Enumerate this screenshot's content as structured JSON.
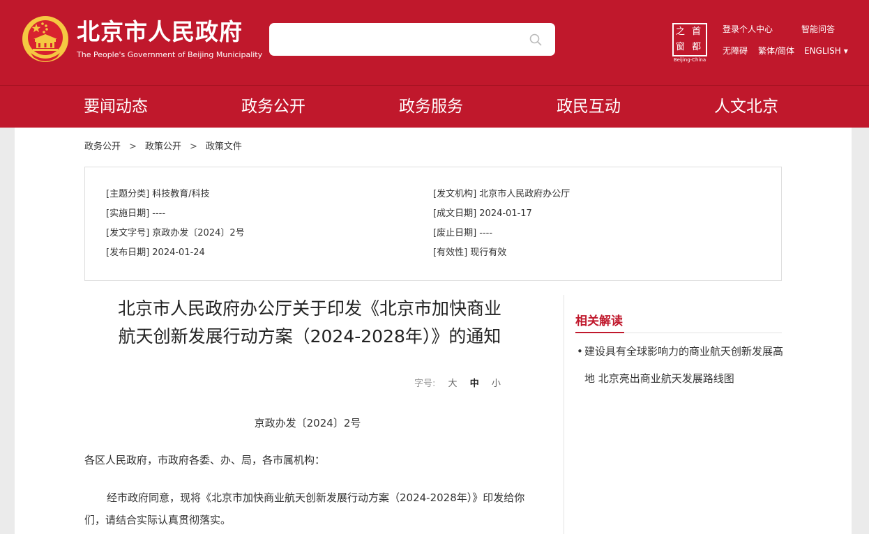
{
  "header": {
    "site_title": "北京市人民政府",
    "site_subtitle": "The People's Government of Beijing Municipality",
    "search": {
      "placeholder": ""
    },
    "capital_logo": {
      "chars": [
        "之",
        "首",
        "窗",
        "都"
      ],
      "caption": "Beijing-China"
    },
    "links": {
      "login": "登录个人中心",
      "smart_qa": "智能问答",
      "accessibility": "无障碍",
      "traditional_simplified": "繁体/简体",
      "english": "ENGLISH"
    }
  },
  "nav": [
    "要闻动态",
    "政务公开",
    "政务服务",
    "政民互动",
    "人文北京"
  ],
  "breadcrumb": [
    "政务公开",
    "政策公开",
    "政策文件"
  ],
  "breadcrumb_sep": ">",
  "meta": {
    "topic": "[主题分类] 科技教育/科技",
    "issuer": "[发文机构] 北京市人民政府办公厅",
    "effective_date": "[实施日期] ----",
    "written_date": "[成文日期] 2024-01-17",
    "doc_no": "[发文字号] 京政办发〔2024〕2号",
    "expiry_date": "[废止日期] ----",
    "publish_date": "[发布日期] 2024-01-24",
    "validity": "[有效性] 现行有效"
  },
  "article": {
    "title_line1": "北京市人民政府办公厅关于印发《北京市加快商业",
    "title_line2": "航天创新发展行动方案（2024-2028年）》的通知",
    "font_size_label": "字号:",
    "font_sizes": [
      "大",
      "中",
      "小"
    ],
    "doc_number": "京政办发〔2024〕2号",
    "salutation": "各区人民政府，市政府各委、办、局，各市属机构：",
    "paragraph": "经市政府同意，现将《北京市加快商业航天创新发展行动方案（2024-2028年）》印发给你们，请结合实际认真贯彻落实。"
  },
  "related": {
    "title": "相关解读",
    "items": [
      "建设具有全球影响力的商业航天创新发展高地 北京亮出商业航天发展路线图"
    ]
  },
  "colors": {
    "brand_red": "#c0182c",
    "emblem_gold": "#f5c842"
  }
}
